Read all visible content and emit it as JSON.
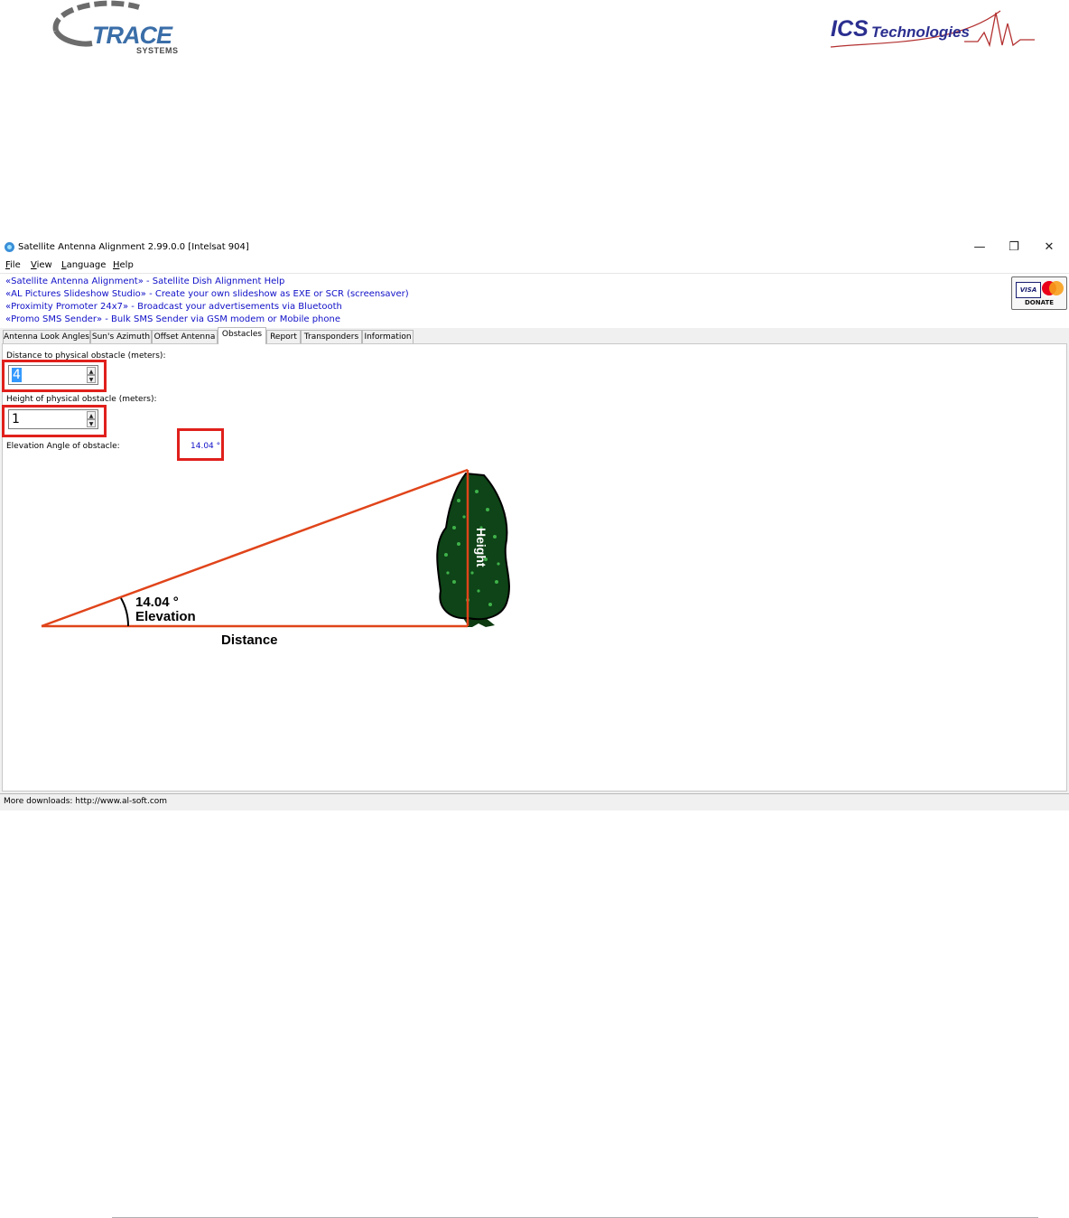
{
  "logos": {
    "trace": {
      "name": "TRACE",
      "sub": "SYSTEMS"
    },
    "ics": {
      "bold": "ICS",
      "rest": "Technologies"
    }
  },
  "window": {
    "title": "Satellite Antenna Alignment 2.99.0.0 [Intelsat 904]",
    "controls": {
      "minimize": "—",
      "maximize": "❐",
      "close": "✕"
    }
  },
  "menu": [
    {
      "key": "F",
      "rest": "ile"
    },
    {
      "key": "V",
      "rest": "iew"
    },
    {
      "key": "L",
      "rest": "anguage"
    },
    {
      "key": "H",
      "rest": "elp"
    }
  ],
  "links": [
    "«Satellite Antenna Alignment» - Satellite Dish Alignment Help",
    "«AL Pictures Slideshow Studio» - Create your own slideshow as EXE or SCR (screensaver)",
    "«Proximity Promoter 24x7» - Broadcast your advertisements via Bluetooth",
    "«Promo SMS Sender» - Bulk SMS Sender via GSM modem or Mobile phone"
  ],
  "donate": {
    "visa": "VISA",
    "label": "DONATE"
  },
  "tabs": [
    "Antenna Look Angles",
    "Sun's Azimuth",
    "Offset Antenna",
    "Obstacles",
    "Report",
    "Transponders",
    "Information"
  ],
  "active_tab": "Obstacles",
  "form": {
    "distance_label": "Distance to physical obstacle (meters):",
    "distance_value": "4",
    "height_label": "Height of physical obstacle (meters):",
    "height_value": "1",
    "elevation_label": "Elevation Angle of obstacle:",
    "elevation_value": "14.04 °"
  },
  "diagram": {
    "angle_text": "14.04 °",
    "elevation_text": "Elevation",
    "distance_text": "Distance",
    "height_text": "Height",
    "line_color": "#e0441a"
  },
  "status": "More downloads: http://www.al-soft.com"
}
